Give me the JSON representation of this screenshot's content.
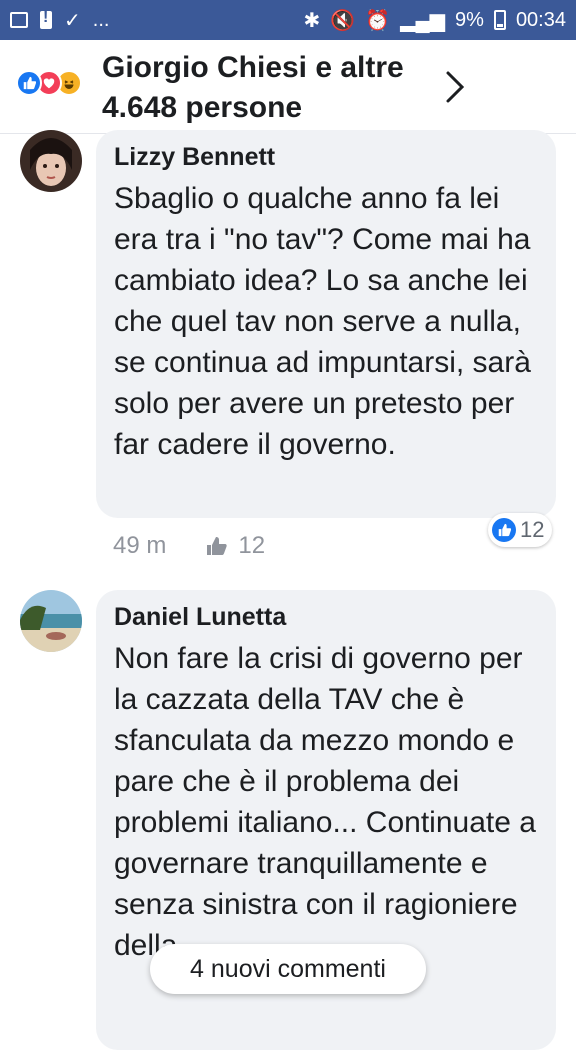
{
  "status_bar": {
    "battery": "9%",
    "time": "00:34",
    "dots": "..."
  },
  "header": {
    "title": "Giorgio Chiesi e altre 4.648 persone",
    "reactions": [
      "like-icon",
      "love-icon",
      "haha-icon"
    ]
  },
  "comments": [
    {
      "author": "Lizzy Bennett",
      "text": "Sbaglio o qualche anno fa lei era tra i \"no tav\"? Come mai ha cambiato idea? Lo sa anche lei che quel tav non serve a nulla, se continua ad impuntarsi, sarà solo per avere un pretesto per far cadere il governo.",
      "time": "49 m",
      "likes": "12",
      "reaction_count": "12"
    },
    {
      "author": "Daniel Lunetta",
      "text": "Non fare la crisi di governo per la cazzata della TAV che è sfanculata da mezzo mondo e pare che è il problema dei problemi italiano... Continuate a governare tranquillamente e senza sinistra con il ragioniere della"
    }
  ],
  "new_comments": "4 nuovi commenti",
  "colors": {
    "status_bar": "#3b5998",
    "bubble": "#f0f2f5",
    "like_blue": "#1877f2",
    "love_red": "#f33e58",
    "haha_yellow": "#f7b125"
  }
}
